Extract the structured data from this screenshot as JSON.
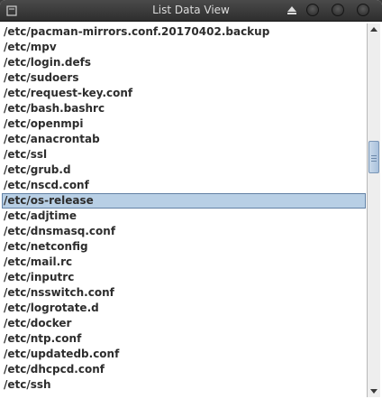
{
  "window": {
    "title": "List Data View"
  },
  "list": {
    "items": [
      "/etc/pacman-mirrors.conf.20170402.backup",
      "/etc/mpv",
      "/etc/login.defs",
      "/etc/sudoers",
      "/etc/request-key.conf",
      "/etc/bash.bashrc",
      "/etc/openmpi",
      "/etc/anacrontab",
      "/etc/ssl",
      "/etc/grub.d",
      "/etc/nscd.conf",
      "/etc/os-release",
      "/etc/adjtime",
      "/etc/dnsmasq.conf",
      "/etc/netconfig",
      "/etc/mail.rc",
      "/etc/inputrc",
      "/etc/nsswitch.conf",
      "/etc/logrotate.d",
      "/etc/docker",
      "/etc/ntp.conf",
      "/etc/updatedb.conf",
      "/etc/dhcpcd.conf",
      "/etc/ssh"
    ],
    "selected_index": 11
  },
  "scrollbar": {
    "position_fraction": 0.33,
    "visible_fraction": 0.07
  },
  "colors": {
    "selection_bg": "#b8cfe5",
    "selection_border": "#6382a5",
    "titlebar": "#3a3a3a"
  }
}
